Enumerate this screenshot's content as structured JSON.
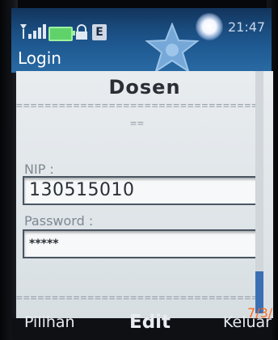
{
  "status": {
    "time": "21:47",
    "network_badge": "E",
    "icons": [
      "signal-icon",
      "battery-icon",
      "lock-icon",
      "edge-badge-icon"
    ]
  },
  "screen": {
    "title": "Login",
    "heading": "Dosen",
    "separator_1": "=======================================",
    "separator_2": "==",
    "separator_3": "======================================="
  },
  "form": {
    "nip_label": "NIP :",
    "nip_value": "130515010",
    "password_label": "Password :",
    "password_value": "*****"
  },
  "softkeys": {
    "left": "Pilihan",
    "middle": "Edit",
    "right": "Keluar"
  },
  "photo_stamp": "7/3/",
  "colors": {
    "status_bg": "#1a4d80",
    "panel_bg": "#e4e9ec",
    "scroll_thumb": "#3b6fb3",
    "stamp": "#ff6a1a"
  }
}
